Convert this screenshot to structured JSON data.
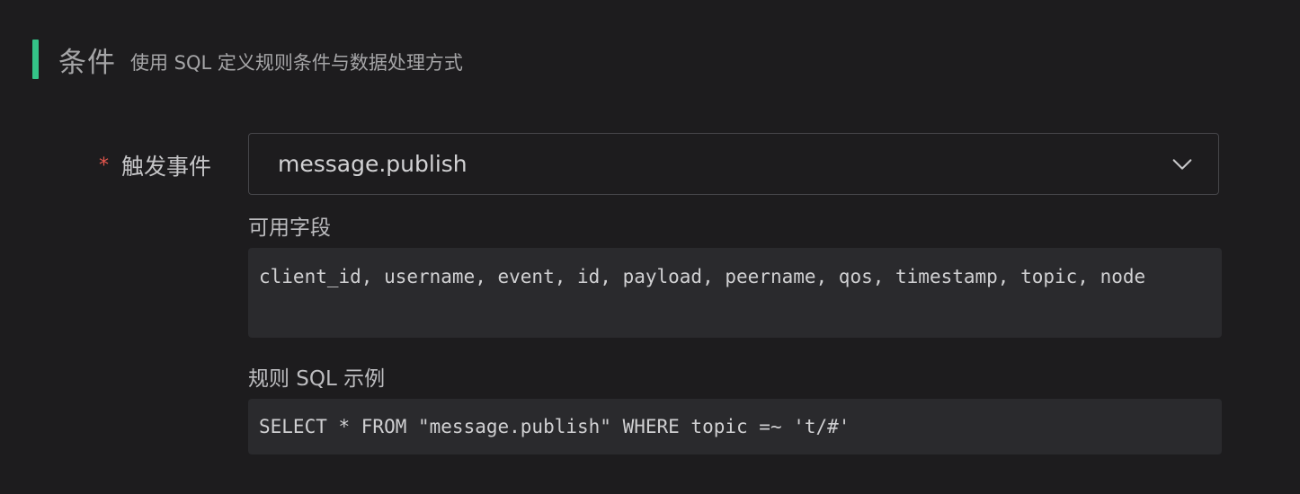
{
  "section": {
    "title": "条件",
    "description": "使用 SQL 定义规则条件与数据处理方式"
  },
  "trigger": {
    "required_mark": "*",
    "label": "触发事件",
    "selected_value": "message.publish"
  },
  "available_fields": {
    "label": "可用字段",
    "value": "client_id, username, event, id, payload, peername, qos, timestamp, topic, node"
  },
  "sql_example": {
    "label": "规则 SQL 示例",
    "value": "SELECT * FROM \"message.publish\" WHERE topic =~ 't/#'"
  },
  "colors": {
    "accent": "#34c388",
    "required": "#e5574e",
    "background": "#1d1c1e",
    "code_background": "#2a2a2d"
  },
  "icons": {
    "dropdown": "chevron-down-icon"
  }
}
